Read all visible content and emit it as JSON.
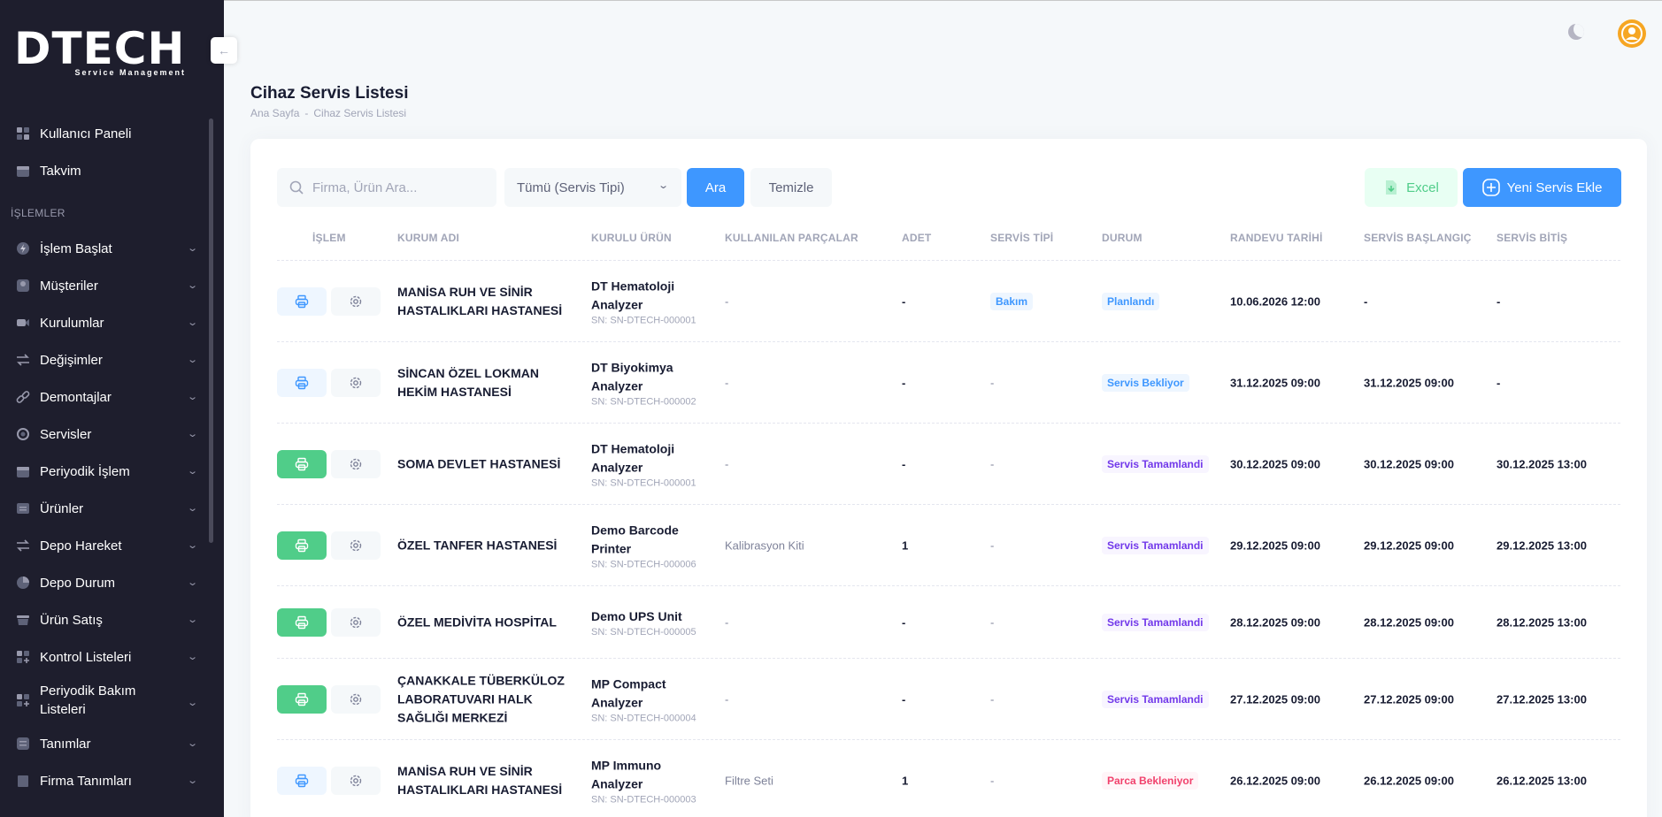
{
  "brand": {
    "logo": "DTECH",
    "tagline": "Service Management"
  },
  "sidebar": {
    "section_label": "İŞLEMLER",
    "top_items": [
      {
        "label": "Kullanıcı Paneli",
        "icon": "dashboard-icon"
      },
      {
        "label": "Takvim",
        "icon": "calendar-icon"
      }
    ],
    "items": [
      {
        "label": "İşlem Başlat",
        "icon": "bolt-icon"
      },
      {
        "label": "Müşteriler",
        "icon": "user-icon"
      },
      {
        "label": "Kurulumlar",
        "icon": "video-icon"
      },
      {
        "label": "Değişimler",
        "icon": "arrows-icon"
      },
      {
        "label": "Demontajlar",
        "icon": "link-icon"
      },
      {
        "label": "Servisler",
        "icon": "service-icon"
      },
      {
        "label": "Periyodik İşlem",
        "icon": "calendar-icon"
      },
      {
        "label": "Ürünler",
        "icon": "box-icon"
      },
      {
        "label": "Depo Hareket",
        "icon": "arrows-icon"
      },
      {
        "label": "Depo Durum",
        "icon": "pie-icon"
      },
      {
        "label": "Ürün Satış",
        "icon": "basket-icon"
      },
      {
        "label": "Kontrol Listeleri",
        "icon": "grid-plus-icon"
      },
      {
        "label": "Periyodik Bakım Listeleri",
        "icon": "grid-plus-icon"
      },
      {
        "label": "Tanımlar",
        "icon": "list-icon"
      },
      {
        "label": "Firma Tanımları",
        "icon": "building-icon"
      }
    ]
  },
  "page": {
    "title": "Cihaz Servis Listesi",
    "breadcrumb": [
      "Ana Sayfa",
      "-",
      "Cihaz Servis Listesi"
    ]
  },
  "toolbar": {
    "search_placeholder": "Firma, Ürün Ara...",
    "service_type_selected": "Tümü (Servis Tipi)",
    "search_button": "Ara",
    "clear_button": "Temizle",
    "excel_button": "Excel",
    "new_button": "Yeni Servis Ekle"
  },
  "table": {
    "columns": [
      "İŞLEM",
      "KURUM ADI",
      "KURULU ÜRÜN",
      "KULLANILAN PARÇALAR",
      "ADET",
      "SERVİS TİPİ",
      "DURUM",
      "RANDEVU TARİHİ",
      "SERVİS BAŞLANGIÇ",
      "SERVİS BİTİŞ"
    ],
    "rows": [
      {
        "org": "MANİSA RUH VE SİNİR HASTALIKLARI HASTANESİ",
        "product": "DT Hematoloji Analyzer",
        "sn": "SN: SN-DTECH-000001",
        "parts": "-",
        "qty": "-",
        "service_type": "Bakım",
        "status": "Planlandı",
        "appointment": "10.06.2026 12:00",
        "start": "-",
        "end": "-"
      },
      {
        "org": "SİNCAN ÖZEL LOKMAN HEKİM HASTANESİ",
        "product": "DT Biyokimya Analyzer",
        "sn": "SN: SN-DTECH-000002",
        "parts": "-",
        "qty": "-",
        "service_type": "-",
        "status": "Servis Bekliyor",
        "appointment": "31.12.2025 09:00",
        "start": "31.12.2025 09:00",
        "end": "-"
      },
      {
        "org": "SOMA DEVLET HASTANESİ",
        "product": "DT Hematoloji Analyzer",
        "sn": "SN: SN-DTECH-000001",
        "parts": "-",
        "qty": "-",
        "service_type": "-",
        "status": "Servis Tamamlandi",
        "appointment": "30.12.2025 09:00",
        "start": "30.12.2025 09:00",
        "end": "30.12.2025 13:00"
      },
      {
        "org": "ÖZEL TANFER HASTANESİ",
        "product": "Demo Barcode Printer",
        "sn": "SN: SN-DTECH-000006",
        "parts": "Kalibrasyon Kiti",
        "qty": "1",
        "service_type": "-",
        "status": "Servis Tamamlandi",
        "appointment": "29.12.2025 09:00",
        "start": "29.12.2025 09:00",
        "end": "29.12.2025 13:00"
      },
      {
        "org": "ÖZEL MEDİVİTA HOSPİTAL",
        "product": "Demo UPS Unit",
        "sn": "SN: SN-DTECH-000005",
        "parts": "-",
        "qty": "-",
        "service_type": "-",
        "status": "Servis Tamamlandi",
        "appointment": "28.12.2025 09:00",
        "start": "28.12.2025 09:00",
        "end": "28.12.2025 13:00"
      },
      {
        "org": "ÇANAKKALE TÜBERKÜLOZ LABORATUVARI HALK SAĞLIĞI MERKEZİ",
        "product": "MP Compact Analyzer",
        "sn": "SN: SN-DTECH-000004",
        "parts": "-",
        "qty": "-",
        "service_type": "-",
        "status": "Servis Tamamlandi",
        "appointment": "27.12.2025 09:00",
        "start": "27.12.2025 09:00",
        "end": "27.12.2025 13:00"
      },
      {
        "org": "MANİSA RUH VE SİNİR HASTALIKLARI HASTANESİ",
        "product": "MP Immuno Analyzer",
        "sn": "SN: SN-DTECH-000003",
        "parts": "Filtre Seti",
        "qty": "1",
        "service_type": "-",
        "status": "Parca Bekleniyor",
        "appointment": "26.12.2025 09:00",
        "start": "26.12.2025 09:00",
        "end": "26.12.2025 13:00"
      }
    ]
  }
}
